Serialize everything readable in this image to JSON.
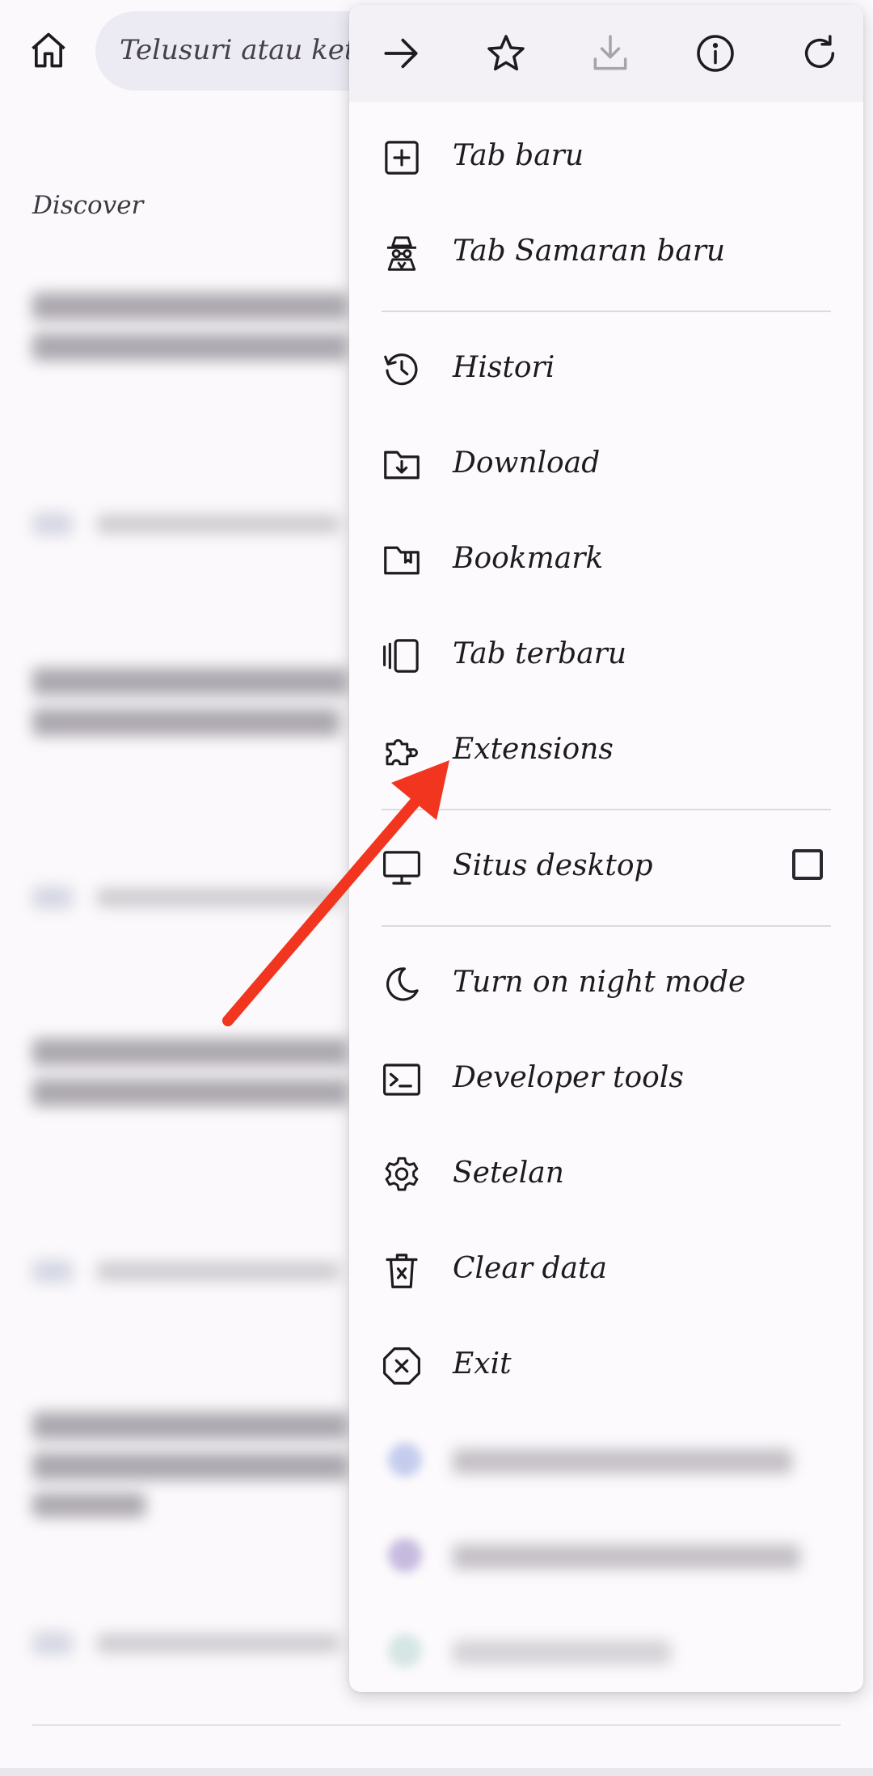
{
  "toolbar": {
    "home_icon": "home-icon",
    "address_placeholder": "Telusuri atau ketik"
  },
  "discover": {
    "heading": "Discover"
  },
  "menu": {
    "top_icons": [
      "forward-icon",
      "star-icon",
      "download-icon",
      "info-icon",
      "reload-icon"
    ],
    "items": [
      {
        "label": "Tab baru",
        "icon": "new-tab-icon"
      },
      {
        "label": "Tab Samaran baru",
        "icon": "incognito-icon"
      },
      {
        "label": "Histori",
        "icon": "history-icon"
      },
      {
        "label": "Download",
        "icon": "downloads-icon"
      },
      {
        "label": "Bookmark",
        "icon": "bookmark-icon"
      },
      {
        "label": "Tab terbaru",
        "icon": "recent-tabs-icon"
      },
      {
        "label": "Extensions",
        "icon": "puzzle-icon"
      },
      {
        "label": "Situs desktop",
        "icon": "desktop-icon",
        "checked": false
      },
      {
        "label": "Turn on night mode",
        "icon": "moon-icon"
      },
      {
        "label": "Developer tools",
        "icon": "terminal-icon"
      },
      {
        "label": "Setelan",
        "icon": "gear-icon"
      },
      {
        "label": "Clear data",
        "icon": "trash-icon"
      },
      {
        "label": "Exit",
        "icon": "close-octagon-icon"
      }
    ]
  },
  "annotation": {
    "color": "#f2351f",
    "points_to": "Extensions"
  }
}
